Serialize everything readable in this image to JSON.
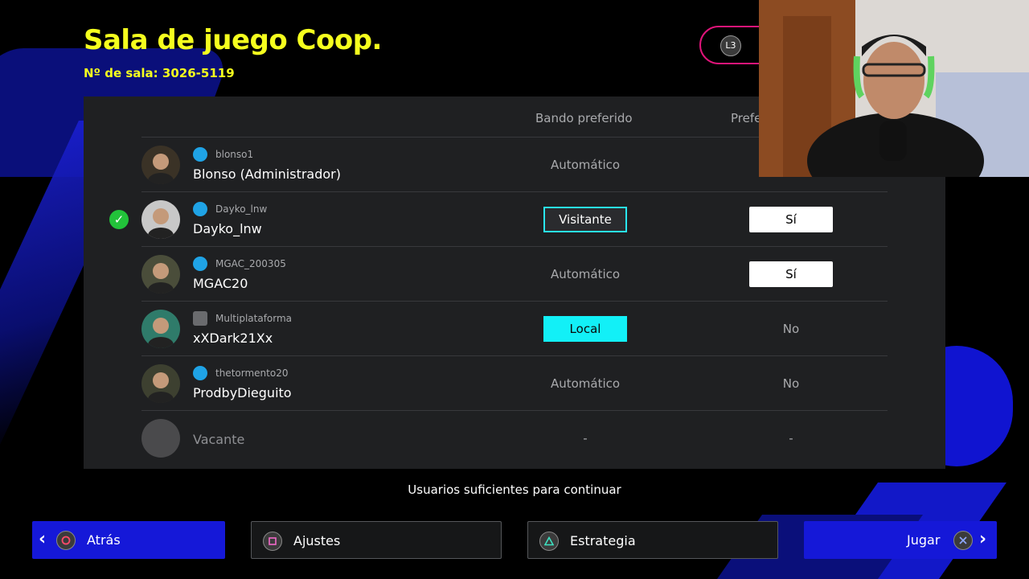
{
  "header": {
    "title": "Sala de juego Coop.",
    "room_number": "Nº de sala: 3026-5119",
    "l3_label": "L3"
  },
  "table": {
    "columns": [
      "Bando preferido",
      "Prefe"
    ],
    "rows": [
      {
        "psn": "blonso1",
        "name": "Blonso (Administrador)",
        "platform": "psn",
        "side": "Automático",
        "side_style": "plain",
        "pref": "",
        "pref_style": "plain",
        "ready": false
      },
      {
        "psn": "Dayko_lnw",
        "name": "Dayko_lnw",
        "platform": "psn",
        "side": "Visitante",
        "side_style": "visitante",
        "pref": "Sí",
        "pref_style": "si",
        "ready": true
      },
      {
        "psn": "MGAC_200305",
        "name": "MGAC20",
        "platform": "psn",
        "side": "Automático",
        "side_style": "plain",
        "pref": "Sí",
        "pref_style": "si",
        "ready": false
      },
      {
        "psn": "Multiplataforma",
        "name": "xXDark21Xx",
        "platform": "multi",
        "side": "Local",
        "side_style": "local",
        "pref": "No",
        "pref_style": "plain",
        "ready": false
      },
      {
        "psn": "thetormento20",
        "name": "ProdbyDieguito",
        "platform": "psn",
        "side": "Automático",
        "side_style": "plain",
        "pref": "No",
        "pref_style": "plain",
        "ready": false
      },
      {
        "psn": "",
        "name": "Vacante",
        "platform": "none",
        "side": "-",
        "side_style": "plain",
        "pref": "-",
        "pref_style": "plain",
        "ready": false
      }
    ]
  },
  "status": "Usuarios suficientes para continuar",
  "buttons": {
    "back": "Atrás",
    "settings": "Ajustes",
    "strategy": "Estrategia",
    "play": "Jugar"
  },
  "colors": {
    "accent_yellow": "#f5ff1e",
    "button_blue": "#1518d8",
    "cyan": "#12f0f7",
    "panel": "#1f2022"
  }
}
